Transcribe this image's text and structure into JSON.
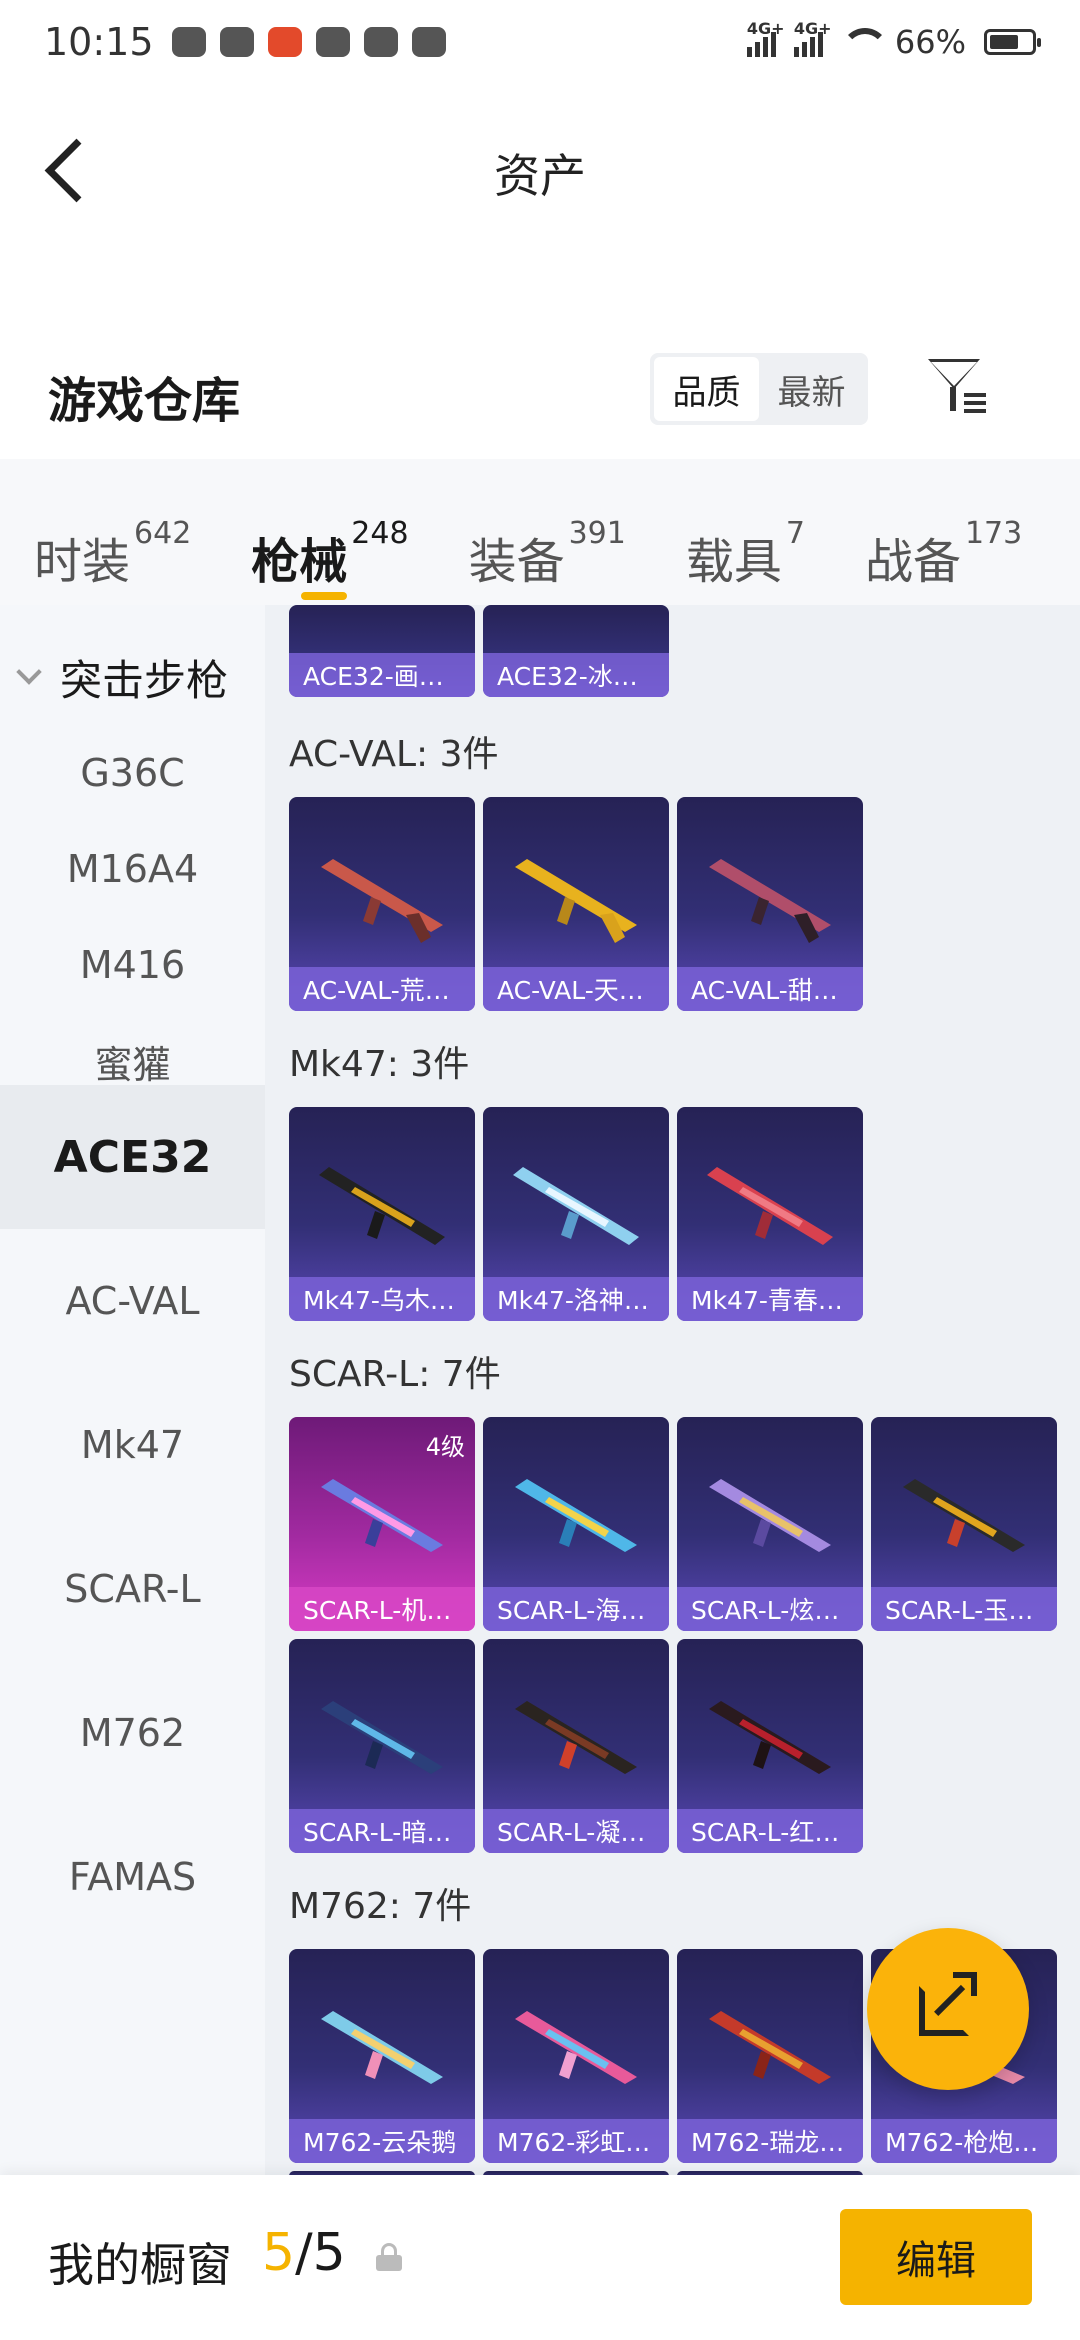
{
  "status_bar": {
    "time": "10:15",
    "signal1": "4G+",
    "signal2": "4G+",
    "battery": "66%"
  },
  "header": {
    "title": "资产"
  },
  "warehouse": {
    "title": "游戏仓库",
    "sort_options": [
      "品质",
      "最新"
    ],
    "sort_selected": "品质"
  },
  "tabs": [
    {
      "label": "时装",
      "count": "642"
    },
    {
      "label": "枪械",
      "count": "248"
    },
    {
      "label": "装备",
      "count": "391"
    },
    {
      "label": "载具",
      "count": "7"
    },
    {
      "label": "战备",
      "count": "173"
    }
  ],
  "active_tab": "枪械",
  "sidenav": {
    "group": "突击步枪",
    "items": [
      "G36C",
      "M16A4",
      "M416",
      "蜜獾",
      "ACE32",
      "AC-VAL",
      "Mk47",
      "SCAR-L",
      "M762",
      "FAMAS"
    ],
    "active": "ACE32"
  },
  "content": {
    "peek_cards": [
      "ACE32-画…",
      "ACE32-冰…"
    ],
    "sections": [
      {
        "title": "AC-VAL: 3件",
        "items": [
          "AC-VAL-荒…",
          "AC-VAL-天…",
          "AC-VAL-甜…"
        ]
      },
      {
        "title": "Mk47: 3件",
        "items": [
          "Mk47-乌木…",
          "Mk47-洛神…",
          "Mk47-青春…"
        ]
      },
      {
        "title": "SCAR-L: 7件",
        "items": [
          "SCAR-L-机…",
          "SCAR-L-海…",
          "SCAR-L-炫…",
          "SCAR-L-玉…",
          "SCAR-L-暗…",
          "SCAR-L-凝…",
          "SCAR-L-红…"
        ],
        "badge": "4级"
      },
      {
        "title": "M762: 7件",
        "items": [
          "M762-云朵鹅",
          "M762-彩虹…",
          "M762-瑞龙…",
          "M762-枪炮…"
        ]
      }
    ]
  },
  "bottom": {
    "label": "我的橱窗",
    "current": "5",
    "separator": "/",
    "total": "5",
    "edit_label": "编辑"
  },
  "colors": {
    "accent": "#f5b300",
    "card_dark": "#2b275e",
    "card_highlight": "#c935b8"
  }
}
